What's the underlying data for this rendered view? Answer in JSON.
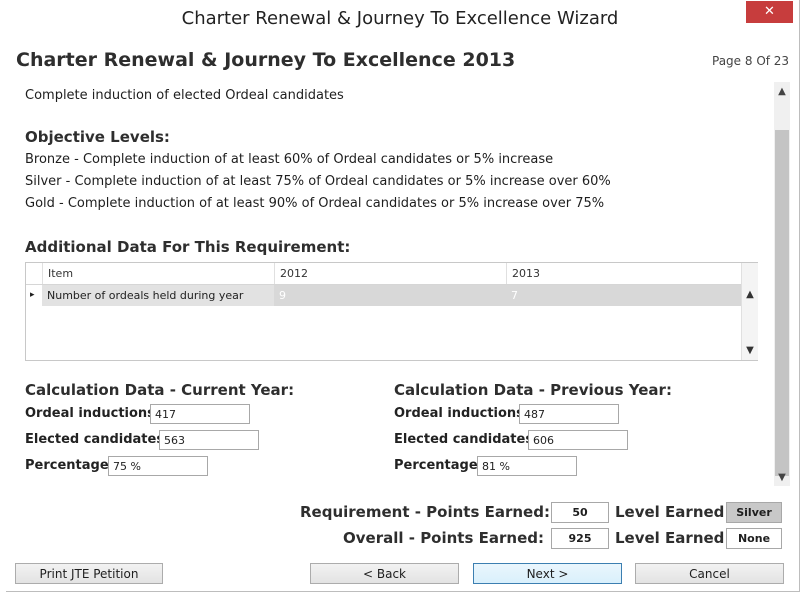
{
  "window": {
    "title": "Charter Renewal & Journey To Excellence Wizard",
    "close_glyph": "✕"
  },
  "header": {
    "title": "Charter Renewal & Journey To Excellence 2013",
    "page_indicator": "Page 8 Of 23"
  },
  "requirement": {
    "description": "Complete induction of elected Ordeal candidates"
  },
  "objectives": {
    "heading": "Objective Levels:",
    "bronze": "Bronze - Complete induction of at least 60% of Ordeal candidates or 5% increase",
    "silver": "Silver - Complete induction of at least 75% of Ordeal candidates or 5% increase over 60%",
    "gold": "Gold - Complete induction of at least 90% of Ordeal candidates or 5% increase over 75%"
  },
  "additional": {
    "heading": "Additional Data For This Requirement:",
    "columns": [
      "Item",
      "2012",
      "2013"
    ],
    "rows": [
      {
        "item": "Number of ordeals held during year",
        "v2012": "9",
        "v2013": "7"
      }
    ]
  },
  "current": {
    "heading": "Calculation Data - Current Year:",
    "inductions_label": "Ordeal inductions:",
    "inductions": "417",
    "elected_label": "Elected candidates:",
    "elected": "563",
    "percentage_label": "Percentage:",
    "percentage": "75 %"
  },
  "previous": {
    "heading": "Calculation Data - Previous Year:",
    "inductions_label": "Ordeal inductions:",
    "inductions": "487",
    "elected_label": "Elected candidates:",
    "elected": "606",
    "percentage_label": "Percentage:",
    "percentage": "81 %"
  },
  "summary": {
    "req_points_label": "Requirement - Points Earned:",
    "req_points": "50",
    "req_level_label": "Level Earned:",
    "req_level": "Silver",
    "overall_points_label": "Overall - Points Earned:",
    "overall_points": "925",
    "overall_level_label": "Level Earned:",
    "overall_level": "None"
  },
  "buttons": {
    "print": "Print JTE Petition",
    "back": "< Back",
    "next": "Next >",
    "cancel": "Cancel"
  },
  "scroll": {
    "up": "▲",
    "down": "▼"
  },
  "row_pointer": "▸"
}
